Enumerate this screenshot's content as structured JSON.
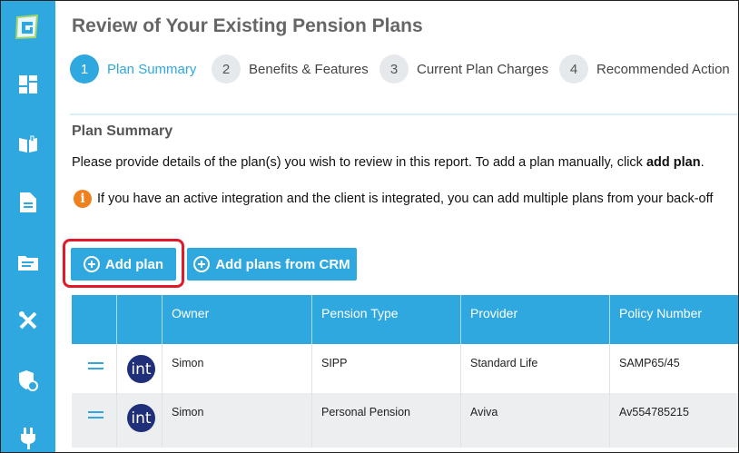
{
  "page": {
    "title": "Review of Your Existing Pension Plans"
  },
  "sidebar": {
    "items": [
      {
        "icon": "brand-logo-icon"
      },
      {
        "icon": "dashboard-icon"
      },
      {
        "icon": "book-icon"
      },
      {
        "icon": "document-icon"
      },
      {
        "icon": "folder-icon"
      },
      {
        "icon": "tools-icon"
      },
      {
        "icon": "shield-icon"
      },
      {
        "icon": "plug-icon"
      }
    ]
  },
  "steps": [
    {
      "number": "1",
      "label": "Plan Summary",
      "active": true
    },
    {
      "number": "2",
      "label": "Benefits & Features",
      "active": false
    },
    {
      "number": "3",
      "label": "Current Plan Charges",
      "active": false
    },
    {
      "number": "4",
      "label": "Recommended Action",
      "active": false
    }
  ],
  "section": {
    "title": "Plan Summary",
    "description_prefix": "Please provide details of the plan(s) you wish to review in this report. To add a plan manually, click ",
    "description_bold": "add plan",
    "description_suffix": ".",
    "info_text": "If you have an active integration and the client is integrated, you can add multiple plans from your back-off"
  },
  "buttons": {
    "add_plan": "Add plan",
    "add_plans_crm": "Add plans from CRM"
  },
  "table": {
    "headers": [
      "",
      "",
      "Owner",
      "Pension Type",
      "Provider",
      "Policy Number"
    ],
    "rows": [
      {
        "logo": "int",
        "owner": "Simon",
        "pension_type": "SIPP",
        "provider": "Standard Life",
        "policy_number": "SAMP65/45"
      },
      {
        "logo": "int",
        "owner": "Simon",
        "pension_type": "Personal Pension",
        "provider": "Aviva",
        "policy_number": "Av554785215"
      }
    ]
  },
  "colors": {
    "accent": "#2fa8e0",
    "highlight": "#e01a2b",
    "info": "#f07f1e",
    "logo_bg": "#1f2f7a"
  }
}
